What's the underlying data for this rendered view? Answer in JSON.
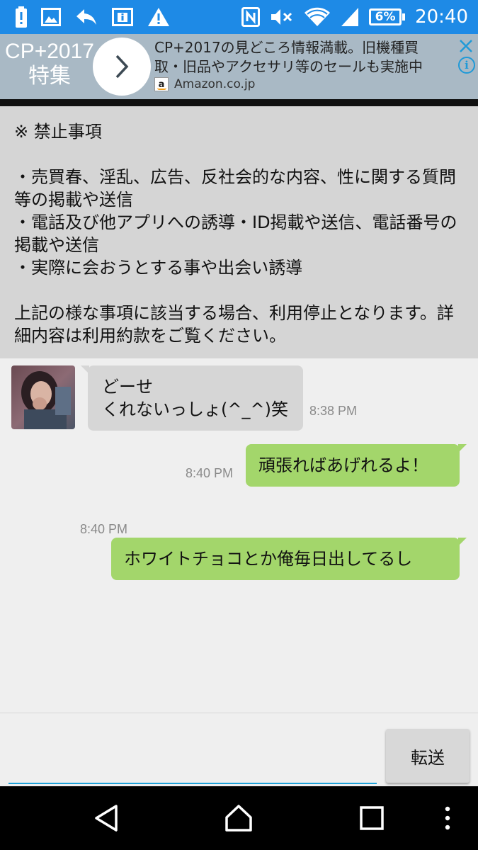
{
  "status_bar": {
    "time": "20:40",
    "battery_percent": "6%",
    "icons_left": [
      "battery-alert-icon",
      "image-icon",
      "reply-icon",
      "info-card-icon",
      "warning-icon"
    ],
    "icons_right": [
      "nfc-icon",
      "mute-icon",
      "wifi-icon",
      "signal-icon"
    ]
  },
  "ad": {
    "left_line1": "CP+2017",
    "left_line2": "特集",
    "headline_line1": "CP+2017の見どころ情報満載。旧機種買",
    "headline_line2": "取・旧品やアクセサリ等のセールも実施中",
    "source": "Amazon.co.jp",
    "badge_letter": "a"
  },
  "notice": {
    "title": "※ 禁止事項",
    "items": [
      "・売買春、淫乱、広告、反社会的な内容、性に関する質問等の掲載や送信",
      "・電話及び他アプリへの誘導・ID掲載や送信、電話番号の掲載や送信",
      "・実際に会おうとする事や出会い誘導"
    ],
    "footer": "上記の様な事項に該当する場合、利用停止となります。詳細内容は利用約款をご覧ください。"
  },
  "messages": [
    {
      "direction": "incoming",
      "line1": "どーせ",
      "line2": "くれないっしょ(^_^)笑",
      "time": "8:38 PM"
    },
    {
      "direction": "outgoing",
      "text": "頑張ればあげれるよ！",
      "time": "8:40 PM"
    },
    {
      "direction": "outgoing",
      "text": "ホワイトチョコとか俺毎日出してるし",
      "time": "8:40 PM"
    }
  ],
  "composer": {
    "value": "",
    "send_label": "転送"
  },
  "colors": {
    "status_bar": "#1e8ae6",
    "outgoing_bubble": "#a3d66b",
    "incoming_bubble": "#d6d6d6",
    "input_underline": "#1ea2d9"
  }
}
